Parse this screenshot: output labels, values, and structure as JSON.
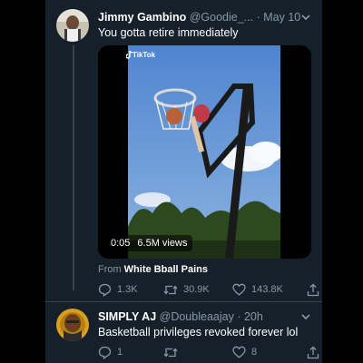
{
  "tweet": {
    "author_name": "Jimmy Gambino",
    "author_handle": "@Goodie_...",
    "separator": "·",
    "date": "May 10",
    "text": "You gotta retire immediately",
    "media": {
      "source_app": "TikTok",
      "duration": "0:05",
      "views": "6.5M views"
    },
    "from_label": "From",
    "from_source": "White Bball Pains",
    "stats": {
      "replies": "1.3K",
      "retweets": "30.9K",
      "likes": "143.8K"
    }
  },
  "reply": {
    "author_name": "SIMPLY AJ",
    "author_handle": "@Doubleaajay",
    "separator": "·",
    "date": "20h",
    "text": "Basketball privileges revoked forever lol",
    "stats": {
      "replies": "1",
      "retweets": "",
      "likes": "8"
    }
  },
  "colors": {
    "background": "#15202b",
    "secondary_text": "#8899a6",
    "divider": "#38444d"
  }
}
